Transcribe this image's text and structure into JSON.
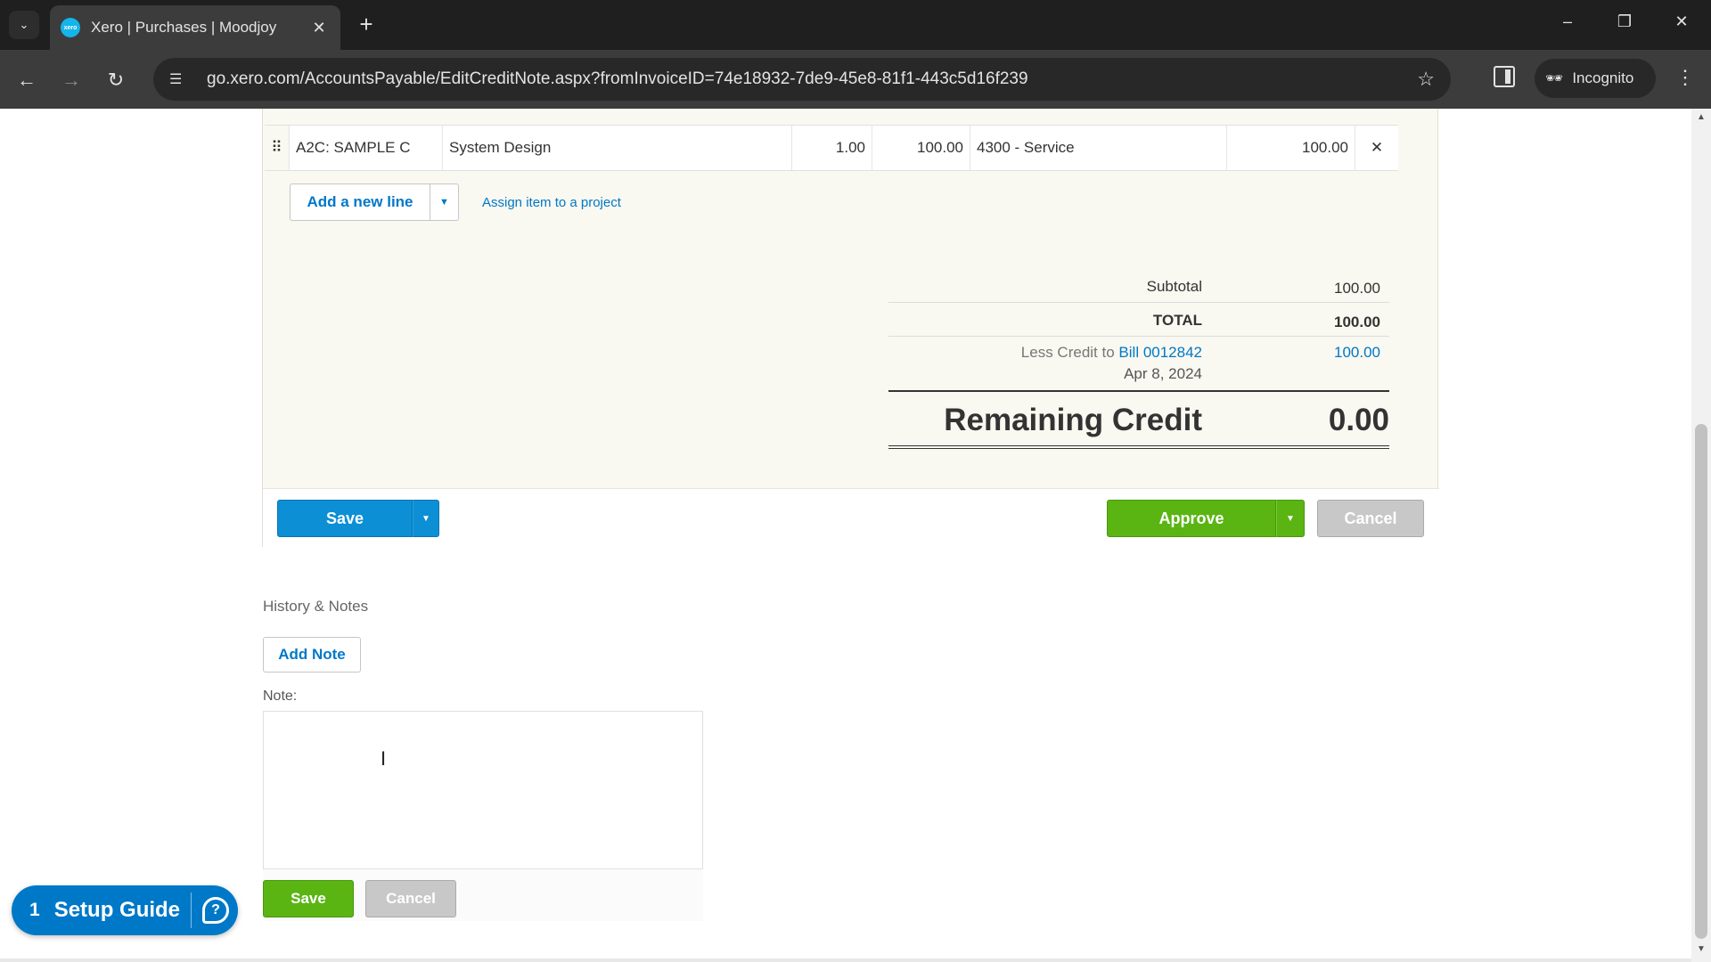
{
  "browser": {
    "tab_title": "Xero | Purchases | Moodjoy",
    "favicon_text": "xero",
    "url": "go.xero.com/AccountsPayable/EditCreditNote.aspx?fromInvoiceID=74e18932-7de9-45e8-81f1-443c5d16f239",
    "incognito_label": "Incognito",
    "icons": {
      "tab_list": "chevron-down-icon",
      "tab_close": "close-icon",
      "new_tab": "plus-icon",
      "back": "arrow-left-icon",
      "forward": "arrow-right-icon",
      "reload": "reload-icon",
      "site_info": "tune-icon",
      "bookmark": "star-icon",
      "menu": "more-vertical-icon"
    }
  },
  "line_item": {
    "item": "A2C: SAMPLE C",
    "description": "System Design",
    "quantity": "1.00",
    "unit_price": "100.00",
    "account": "4300 - Service",
    "amount": "100.00"
  },
  "line_actions": {
    "add_line_label": "Add a new line",
    "assign_project_label": "Assign item to a project"
  },
  "totals": {
    "subtotal_label": "Subtotal",
    "subtotal_value": "100.00",
    "total_label": "TOTAL",
    "total_value": "100.00",
    "less_credit_prefix": "Less Credit to",
    "credit_bill_link": "Bill 0012842",
    "credit_date": "Apr 8, 2024",
    "credit_value": "100.00",
    "remaining_label": "Remaining Credit",
    "remaining_value": "0.00"
  },
  "actions": {
    "save_label": "Save",
    "approve_label": "Approve",
    "cancel_label": "Cancel"
  },
  "history": {
    "title": "History & Notes",
    "add_note_label": "Add Note",
    "note_label": "Note:",
    "note_value": "",
    "save_label": "Save",
    "cancel_label": "Cancel"
  },
  "setup_guide": {
    "count": "1",
    "label": "Setup Guide"
  },
  "colors": {
    "xero_blue": "#0078c8",
    "save_blue": "#0d8fd6",
    "approve_green": "#5ab513",
    "cancel_grey": "#c8c8c8",
    "panel_bg": "#f9f8f1"
  }
}
